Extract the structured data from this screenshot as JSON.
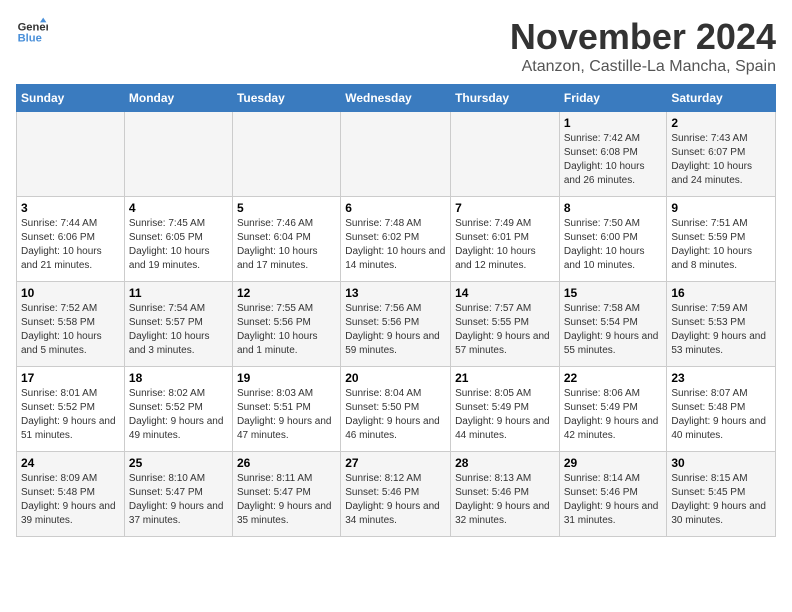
{
  "logo": {
    "line1": "General",
    "line2": "Blue"
  },
  "title": "November 2024",
  "location": "Atanzon, Castille-La Mancha, Spain",
  "weekdays": [
    "Sunday",
    "Monday",
    "Tuesday",
    "Wednesday",
    "Thursday",
    "Friday",
    "Saturday"
  ],
  "weeks": [
    [
      {
        "day": "",
        "info": ""
      },
      {
        "day": "",
        "info": ""
      },
      {
        "day": "",
        "info": ""
      },
      {
        "day": "",
        "info": ""
      },
      {
        "day": "",
        "info": ""
      },
      {
        "day": "1",
        "info": "Sunrise: 7:42 AM\nSunset: 6:08 PM\nDaylight: 10 hours and 26 minutes."
      },
      {
        "day": "2",
        "info": "Sunrise: 7:43 AM\nSunset: 6:07 PM\nDaylight: 10 hours and 24 minutes."
      }
    ],
    [
      {
        "day": "3",
        "info": "Sunrise: 7:44 AM\nSunset: 6:06 PM\nDaylight: 10 hours and 21 minutes."
      },
      {
        "day": "4",
        "info": "Sunrise: 7:45 AM\nSunset: 6:05 PM\nDaylight: 10 hours and 19 minutes."
      },
      {
        "day": "5",
        "info": "Sunrise: 7:46 AM\nSunset: 6:04 PM\nDaylight: 10 hours and 17 minutes."
      },
      {
        "day": "6",
        "info": "Sunrise: 7:48 AM\nSunset: 6:02 PM\nDaylight: 10 hours and 14 minutes."
      },
      {
        "day": "7",
        "info": "Sunrise: 7:49 AM\nSunset: 6:01 PM\nDaylight: 10 hours and 12 minutes."
      },
      {
        "day": "8",
        "info": "Sunrise: 7:50 AM\nSunset: 6:00 PM\nDaylight: 10 hours and 10 minutes."
      },
      {
        "day": "9",
        "info": "Sunrise: 7:51 AM\nSunset: 5:59 PM\nDaylight: 10 hours and 8 minutes."
      }
    ],
    [
      {
        "day": "10",
        "info": "Sunrise: 7:52 AM\nSunset: 5:58 PM\nDaylight: 10 hours and 5 minutes."
      },
      {
        "day": "11",
        "info": "Sunrise: 7:54 AM\nSunset: 5:57 PM\nDaylight: 10 hours and 3 minutes."
      },
      {
        "day": "12",
        "info": "Sunrise: 7:55 AM\nSunset: 5:56 PM\nDaylight: 10 hours and 1 minute."
      },
      {
        "day": "13",
        "info": "Sunrise: 7:56 AM\nSunset: 5:56 PM\nDaylight: 9 hours and 59 minutes."
      },
      {
        "day": "14",
        "info": "Sunrise: 7:57 AM\nSunset: 5:55 PM\nDaylight: 9 hours and 57 minutes."
      },
      {
        "day": "15",
        "info": "Sunrise: 7:58 AM\nSunset: 5:54 PM\nDaylight: 9 hours and 55 minutes."
      },
      {
        "day": "16",
        "info": "Sunrise: 7:59 AM\nSunset: 5:53 PM\nDaylight: 9 hours and 53 minutes."
      }
    ],
    [
      {
        "day": "17",
        "info": "Sunrise: 8:01 AM\nSunset: 5:52 PM\nDaylight: 9 hours and 51 minutes."
      },
      {
        "day": "18",
        "info": "Sunrise: 8:02 AM\nSunset: 5:52 PM\nDaylight: 9 hours and 49 minutes."
      },
      {
        "day": "19",
        "info": "Sunrise: 8:03 AM\nSunset: 5:51 PM\nDaylight: 9 hours and 47 minutes."
      },
      {
        "day": "20",
        "info": "Sunrise: 8:04 AM\nSunset: 5:50 PM\nDaylight: 9 hours and 46 minutes."
      },
      {
        "day": "21",
        "info": "Sunrise: 8:05 AM\nSunset: 5:49 PM\nDaylight: 9 hours and 44 minutes."
      },
      {
        "day": "22",
        "info": "Sunrise: 8:06 AM\nSunset: 5:49 PM\nDaylight: 9 hours and 42 minutes."
      },
      {
        "day": "23",
        "info": "Sunrise: 8:07 AM\nSunset: 5:48 PM\nDaylight: 9 hours and 40 minutes."
      }
    ],
    [
      {
        "day": "24",
        "info": "Sunrise: 8:09 AM\nSunset: 5:48 PM\nDaylight: 9 hours and 39 minutes."
      },
      {
        "day": "25",
        "info": "Sunrise: 8:10 AM\nSunset: 5:47 PM\nDaylight: 9 hours and 37 minutes."
      },
      {
        "day": "26",
        "info": "Sunrise: 8:11 AM\nSunset: 5:47 PM\nDaylight: 9 hours and 35 minutes."
      },
      {
        "day": "27",
        "info": "Sunrise: 8:12 AM\nSunset: 5:46 PM\nDaylight: 9 hours and 34 minutes."
      },
      {
        "day": "28",
        "info": "Sunrise: 8:13 AM\nSunset: 5:46 PM\nDaylight: 9 hours and 32 minutes."
      },
      {
        "day": "29",
        "info": "Sunrise: 8:14 AM\nSunset: 5:46 PM\nDaylight: 9 hours and 31 minutes."
      },
      {
        "day": "30",
        "info": "Sunrise: 8:15 AM\nSunset: 5:45 PM\nDaylight: 9 hours and 30 minutes."
      }
    ]
  ]
}
